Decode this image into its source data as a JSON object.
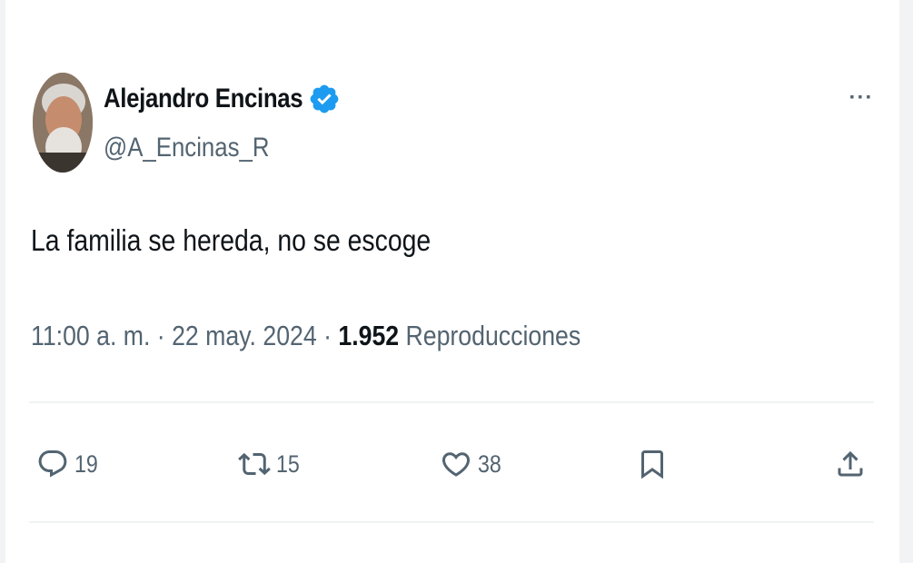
{
  "tweet": {
    "author": {
      "display_name": "Alejandro Encinas",
      "handle": "@A_Encinas_R",
      "verified": true
    },
    "more_label": "···",
    "text": "La familia se hereda, no se escoge",
    "time": "11:00 a. m.",
    "date": "22 may. 2024",
    "separator": " · ",
    "views_count": "1.952",
    "views_label": "Reproducciones",
    "actions": {
      "replies": "19",
      "reposts": "15",
      "likes": "38"
    }
  },
  "colors": {
    "verified_blue": "#1d9bf0",
    "secondary_text": "#536471",
    "primary_text": "#0f1419",
    "divider": "#eff3f4"
  },
  "icons": [
    "reply-icon",
    "repost-icon",
    "like-icon",
    "bookmark-icon",
    "share-icon",
    "verified-badge-icon",
    "more-icon"
  ]
}
